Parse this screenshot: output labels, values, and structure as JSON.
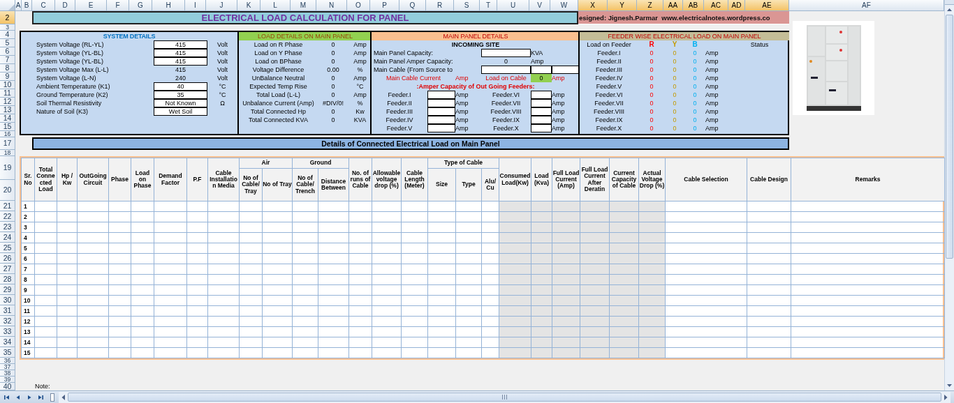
{
  "column_headers": [
    {
      "label": "A",
      "selected": false
    },
    {
      "label": "B",
      "selected": false
    },
    {
      "label": "C",
      "selected": false
    },
    {
      "label": "D",
      "selected": false
    },
    {
      "label": "E",
      "selected": false
    },
    {
      "label": "F",
      "selected": false
    },
    {
      "label": "G",
      "selected": false
    },
    {
      "label": "H",
      "selected": false
    },
    {
      "label": "I",
      "selected": false
    },
    {
      "label": "J",
      "selected": false
    },
    {
      "label": "K",
      "selected": false
    },
    {
      "label": "L",
      "selected": false
    },
    {
      "label": "M",
      "selected": false
    },
    {
      "label": "N",
      "selected": false
    },
    {
      "label": "O",
      "selected": false
    },
    {
      "label": "P",
      "selected": false
    },
    {
      "label": "Q",
      "selected": false
    },
    {
      "label": "R",
      "selected": false
    },
    {
      "label": "S",
      "selected": false
    },
    {
      "label": "T",
      "selected": false
    },
    {
      "label": "U",
      "selected": false
    },
    {
      "label": "V",
      "selected": false
    },
    {
      "label": "W",
      "selected": false
    },
    {
      "label": "X",
      "selected": true
    },
    {
      "label": "Y",
      "selected": true
    },
    {
      "label": "Z",
      "selected": true
    },
    {
      "label": "AA",
      "selected": true
    },
    {
      "label": "AB",
      "selected": true
    },
    {
      "label": "AC",
      "selected": true
    },
    {
      "label": "AD",
      "selected": true
    },
    {
      "label": "AE",
      "selected": true
    },
    {
      "label": "AF",
      "selected": false
    }
  ],
  "row_headers": [
    {
      "label": "2",
      "selected": true
    },
    {
      "label": "3",
      "selected": false
    },
    {
      "label": "4",
      "selected": false
    },
    {
      "label": "5",
      "selected": false
    },
    {
      "label": "6",
      "selected": false
    },
    {
      "label": "7",
      "selected": false
    },
    {
      "label": "8",
      "selected": false
    },
    {
      "label": "9",
      "selected": false
    },
    {
      "label": "10",
      "selected": false
    },
    {
      "label": "11",
      "selected": false
    },
    {
      "label": "12",
      "selected": false
    },
    {
      "label": "13",
      "selected": false
    },
    {
      "label": "14",
      "selected": false
    },
    {
      "label": "15",
      "selected": false
    },
    {
      "label": "16",
      "selected": false
    },
    {
      "label": "17",
      "selected": false
    },
    {
      "label": "18",
      "selected": false
    },
    {
      "label": "19",
      "selected": false
    },
    {
      "label": "20",
      "selected": false
    },
    {
      "label": "21",
      "selected": false
    },
    {
      "label": "22",
      "selected": false
    },
    {
      "label": "23",
      "selected": false
    },
    {
      "label": "24",
      "selected": false
    },
    {
      "label": "25",
      "selected": false
    },
    {
      "label": "26",
      "selected": false
    },
    {
      "label": "27",
      "selected": false
    },
    {
      "label": "28",
      "selected": false
    },
    {
      "label": "29",
      "selected": false
    },
    {
      "label": "30",
      "selected": false
    },
    {
      "label": "31",
      "selected": false
    },
    {
      "label": "32",
      "selected": false
    },
    {
      "label": "33",
      "selected": false
    },
    {
      "label": "34",
      "selected": false
    },
    {
      "label": "35",
      "selected": false
    },
    {
      "label": "36",
      "selected": false
    },
    {
      "label": "37",
      "selected": false
    },
    {
      "label": "38",
      "selected": false
    },
    {
      "label": "39",
      "selected": false
    },
    {
      "label": "40",
      "selected": false
    }
  ],
  "title_bar": {
    "title": "ELECTRICAL LOAD CALCULATION FOR PANEL",
    "credit": "esigned: Jignesh.Parmar  www.electricalnotes.wordpress.co"
  },
  "system_details": {
    "title": "SYSTEM DETAILS",
    "rows": [
      {
        "label": "System Voltage (RL-YL)",
        "value": "415",
        "unit": "Volt",
        "kind": "input"
      },
      {
        "label": "System Voltage (YL-BL)",
        "value": "415",
        "unit": "Volt",
        "kind": "input"
      },
      {
        "label": "System Voltage (YL-BL)",
        "value": "415",
        "unit": "Volt",
        "kind": "input"
      },
      {
        "label": "System Voltage Max (L-L)",
        "value": "415",
        "unit": "Volt",
        "kind": "calc"
      },
      {
        "label": "System Voltage (L-N)",
        "value": "240",
        "unit": "Volt",
        "kind": "calc"
      },
      {
        "label": "Ambient Temperature (K1)",
        "value": "40",
        "unit": "°C",
        "kind": "input"
      },
      {
        "label": "Ground Temperature (K2)",
        "value": "35",
        "unit": "°C",
        "kind": "input"
      },
      {
        "label": "Soil Thermal Resistivity",
        "value": "Not Known",
        "unit": "Ω",
        "kind": "input"
      },
      {
        "label": "Nature of Soil (K3)",
        "value": "Wet Soil",
        "unit": "",
        "kind": "input"
      }
    ]
  },
  "load_details": {
    "title": "LOAD DETAILS ON MAIN PANEL",
    "rows": [
      {
        "label": "Load on R Phase",
        "value": "0",
        "unit": "Amp"
      },
      {
        "label": "Load on Y Phase",
        "value": "0",
        "unit": "Amp"
      },
      {
        "label": "Load on BPhase",
        "value": "0",
        "unit": "Amp"
      },
      {
        "label": "Voltage Difference",
        "value": "0.00",
        "unit": "%"
      },
      {
        "label": "UnBalance Neutral",
        "value": "0",
        "unit": "Amp"
      },
      {
        "label": "Expected Temp Rise",
        "value": "0",
        "unit": "°C"
      },
      {
        "label": "Total Load (L-L)",
        "value": "0",
        "unit": "Amp"
      },
      {
        "label": "Unbalance Current (Amp)",
        "value": "#DIV/0!",
        "unit": "%"
      },
      {
        "label": "Total Connected Hp",
        "value": "0",
        "unit": "Kw"
      },
      {
        "label": "Total Connected KVA",
        "value": "0",
        "unit": "KVA"
      }
    ]
  },
  "main_panel": {
    "title": "MAIN PANEL DETAILS",
    "subtitle": "INCOMING SITE",
    "capacity": {
      "label": "Main Panel Capacity:",
      "unit": "KVA"
    },
    "amper_capacity": {
      "label": "Main Panel Amper Capacity:",
      "value": "0",
      "unit": "Amp"
    },
    "main_cable": {
      "label": "Main Cable (From Source to"
    },
    "cable_current": {
      "label": "Main Cable Current",
      "unit": "Amp"
    },
    "load_on_cable": {
      "label": "Load on Cable",
      "value": "0",
      "unit": "Amp"
    },
    "feeders_heading": ":Amper Capacity of Out Going Feeders:",
    "feeders": [
      {
        "name": "Feeder.I",
        "unit": "Amp"
      },
      {
        "name": "Feeder.II",
        "unit": "Amp"
      },
      {
        "name": "Feeder.III",
        "unit": "Amp"
      },
      {
        "name": "Feeder.IV",
        "unit": "Amp"
      },
      {
        "name": "Feeder.V",
        "unit": "Amp"
      },
      {
        "name": "Feeder.VI",
        "unit": "Amp"
      },
      {
        "name": "Feeder.VII",
        "unit": "Amp"
      },
      {
        "name": "Feeder.VIII",
        "unit": "Amp"
      },
      {
        "name": "Feeder.IX",
        "unit": "Amp"
      },
      {
        "name": "Feeder.X",
        "unit": "Amp"
      }
    ]
  },
  "feeder_load": {
    "title": "FEEDER WISE ELECTRICAL LOAD ON MAIN PANEL",
    "header": "Load on Feeder",
    "status_header": "Status",
    "phases": [
      {
        "label": "R",
        "color": "#ff0000"
      },
      {
        "label": "Y",
        "color": "#c49a00"
      },
      {
        "label": "B",
        "color": "#00b0f0"
      }
    ],
    "rows": [
      {
        "name": "Feeder.I",
        "values": [
          "0",
          "0",
          "0"
        ],
        "unit": "Amp"
      },
      {
        "name": "Feeder.II",
        "values": [
          "0",
          "0",
          "0"
        ],
        "unit": "Amp"
      },
      {
        "name": "Feeder.III",
        "values": [
          "0",
          "0",
          "0"
        ],
        "unit": "Amp"
      },
      {
        "name": "Feeder.IV",
        "values": [
          "0",
          "0",
          "0"
        ],
        "unit": "Amp"
      },
      {
        "name": "Feeder.V",
        "values": [
          "0",
          "0",
          "0"
        ],
        "unit": "Amp"
      },
      {
        "name": "Feeder.VI",
        "values": [
          "0",
          "0",
          "0"
        ],
        "unit": "Amp"
      },
      {
        "name": "Feeder.VII",
        "values": [
          "0",
          "0",
          "0"
        ],
        "unit": "Amp"
      },
      {
        "name": "Feeder.VIII",
        "values": [
          "0",
          "0",
          "0"
        ],
        "unit": "Amp"
      },
      {
        "name": "Feeder.IX",
        "values": [
          "0",
          "0",
          "0"
        ],
        "unit": "Amp"
      },
      {
        "name": "Feeder.X",
        "values": [
          "0",
          "0",
          "0"
        ],
        "unit": "Amp"
      }
    ]
  },
  "section_title": "Details of Connected Electrical Load on Main Panel",
  "table": {
    "columns": [
      {
        "label": "Sr. No",
        "shaded": false
      },
      {
        "label": "Total Connected Load",
        "shaded": false
      },
      {
        "label": "Hp / Kw",
        "shaded": false
      },
      {
        "label": "OutGoing Circuit",
        "shaded": false
      },
      {
        "label": "Phase",
        "shaded": false
      },
      {
        "label": "Load on Phase",
        "shaded": false
      },
      {
        "label": "Demand Factor",
        "shaded": false
      },
      {
        "label": "P.F",
        "shaded": false
      },
      {
        "label": "Cable Installation Media",
        "shaded": false
      },
      {
        "group": "Air",
        "children": [
          {
            "label": "No of Cable/ Tray",
            "shaded": false
          },
          {
            "label": "No of Tray",
            "shaded": false
          }
        ]
      },
      {
        "group": "Ground",
        "children": [
          {
            "label": "No of Cable/ Trench",
            "shaded": false
          },
          {
            "label": "Distance Between",
            "shaded": false
          }
        ]
      },
      {
        "label": "No. of runs of Cable",
        "shaded": false
      },
      {
        "label": "Allowable voltage drop (%)",
        "shaded": false
      },
      {
        "label": "Cable Length (Meter)",
        "shaded": false
      },
      {
        "group": "Type of Cable",
        "children": [
          {
            "label": "Size",
            "shaded": false
          },
          {
            "label": "Type",
            "shaded": false
          },
          {
            "label": "Alu/ Cu",
            "shaded": false
          }
        ]
      },
      {
        "label": "Consumed Load(Kw)",
        "shaded": true
      },
      {
        "label": "Load (Kva)",
        "shaded": true
      },
      {
        "label": "Full Load Current (Amp)",
        "shaded": true
      },
      {
        "label": "Full Load Current After Deratin",
        "shaded": true
      },
      {
        "label": "Current Capacity of Cable",
        "shaded": true
      },
      {
        "label": "Actual Voltage Drop (%)",
        "shaded": true
      },
      {
        "label": "Cable Selection",
        "shaded": false
      },
      {
        "label": "Cable Design",
        "shaded": false
      },
      {
        "label": "Remarks",
        "shaded": false
      }
    ],
    "rows": [
      {
        "sr": "1"
      },
      {
        "sr": "2"
      },
      {
        "sr": "3"
      },
      {
        "sr": "4"
      },
      {
        "sr": "5"
      },
      {
        "sr": "6"
      },
      {
        "sr": "7"
      },
      {
        "sr": "8"
      },
      {
        "sr": "9"
      },
      {
        "sr": "10"
      },
      {
        "sr": "11"
      },
      {
        "sr": "12"
      },
      {
        "sr": "13"
      },
      {
        "sr": "14"
      },
      {
        "sr": "15"
      }
    ]
  },
  "note": "Note:"
}
